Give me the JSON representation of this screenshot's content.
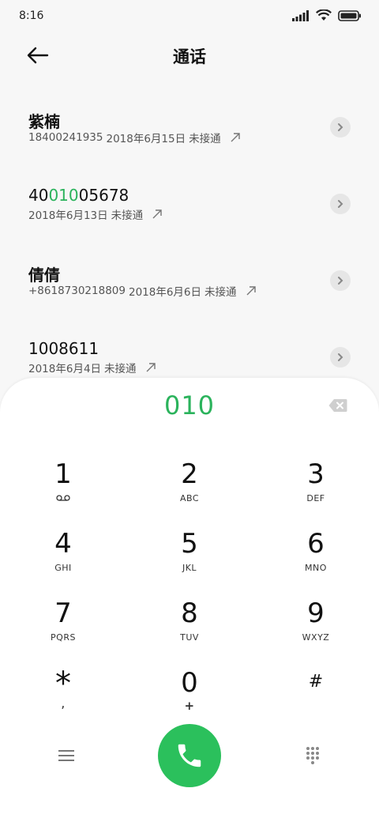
{
  "status_bar": {
    "time": "8:16"
  },
  "header": {
    "title": "通话"
  },
  "calls": [
    {
      "name_pre": "紫楠",
      "name_hl": "",
      "name_post": "",
      "number": "18400241935",
      "date": "2018年6月15日",
      "status": "未接通"
    },
    {
      "name_pre": "40",
      "name_hl": "010",
      "name_post": "05678",
      "number": "",
      "date": "2018年6月13日",
      "status": "未接通"
    },
    {
      "name_pre": "倩倩",
      "name_hl": "",
      "name_post": "",
      "number": "+8618730218809",
      "date": "2018年6月6日",
      "status": "未接通"
    },
    {
      "name_pre": "1008611",
      "name_hl": "",
      "name_post": "",
      "number": "",
      "date": "2018年6月4日",
      "status": "未接通"
    }
  ],
  "dialpad": {
    "input": "010",
    "keys": [
      {
        "digit": "1",
        "letters": ""
      },
      {
        "digit": "2",
        "letters": "ABC"
      },
      {
        "digit": "3",
        "letters": "DEF"
      },
      {
        "digit": "4",
        "letters": "GHI"
      },
      {
        "digit": "5",
        "letters": "JKL"
      },
      {
        "digit": "6",
        "letters": "MNO"
      },
      {
        "digit": "7",
        "letters": "PQRS"
      },
      {
        "digit": "8",
        "letters": "TUV"
      },
      {
        "digit": "9",
        "letters": "WXYZ"
      },
      {
        "digit": "*",
        "letters": ","
      },
      {
        "digit": "0",
        "letters": "+"
      },
      {
        "digit": "#",
        "letters": ""
      }
    ]
  },
  "colors": {
    "accent": "#2bb35c",
    "call_button": "#2bc05c"
  }
}
